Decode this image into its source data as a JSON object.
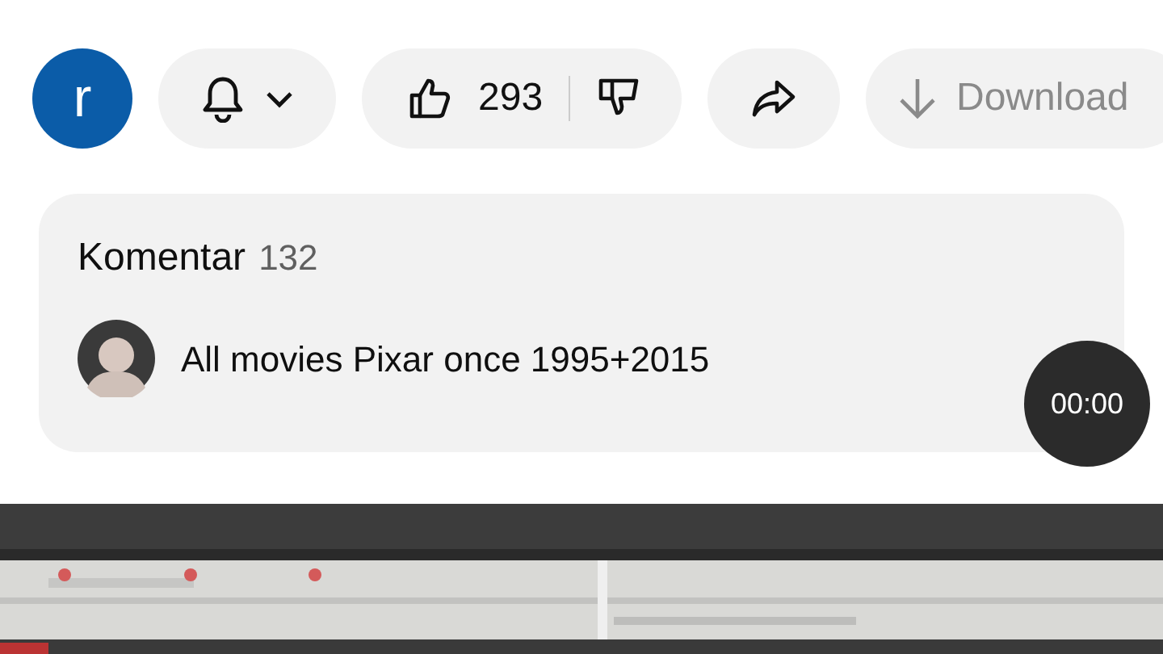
{
  "channel_avatar": {
    "letter": "r"
  },
  "actions": {
    "like_count": "293",
    "download": {
      "label": "Download",
      "disabled": true
    }
  },
  "comments": {
    "title": "Komentar",
    "count": "132",
    "top_comment": "All movies Pixar once 1995+2015"
  },
  "timer": "00:00"
}
